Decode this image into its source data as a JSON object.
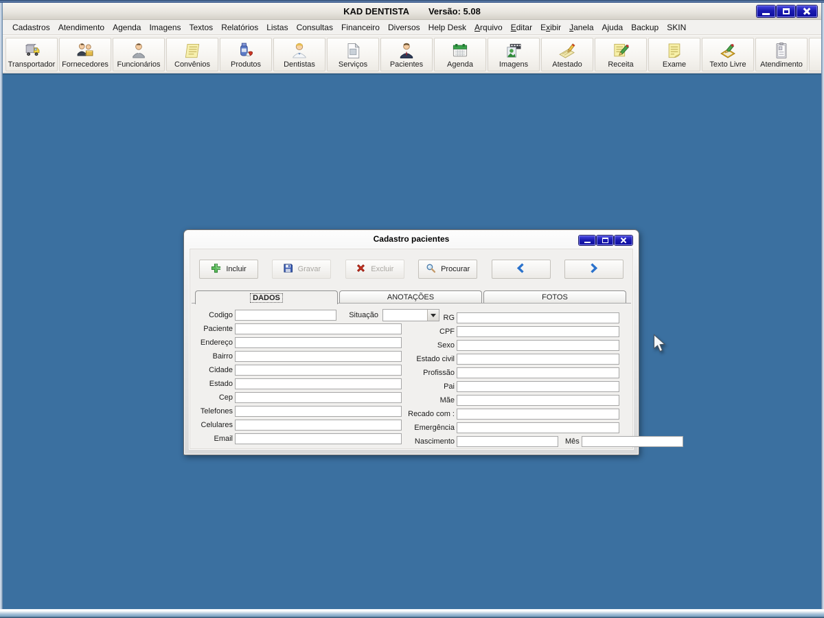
{
  "window": {
    "app_title": "KAD DENTISTA",
    "version": "Versão: 5.08",
    "controls": [
      "minimize",
      "maximize",
      "close"
    ]
  },
  "menu": {
    "items": [
      {
        "id": "cadastros",
        "label": "Cadastros",
        "u": -1
      },
      {
        "id": "atendimento",
        "label": "Atendimento",
        "u": -1
      },
      {
        "id": "agenda",
        "label": "Agenda",
        "u": -1
      },
      {
        "id": "imagens",
        "label": "Imagens",
        "u": -1
      },
      {
        "id": "textos",
        "label": "Textos",
        "u": -1
      },
      {
        "id": "relatorios",
        "label": "Relatórios",
        "u": -1
      },
      {
        "id": "listas",
        "label": "Listas",
        "u": -1
      },
      {
        "id": "consultas",
        "label": "Consultas",
        "u": -1
      },
      {
        "id": "financeiro",
        "label": "Financeiro",
        "u": -1
      },
      {
        "id": "diversos",
        "label": "Diversos",
        "u": -1
      },
      {
        "id": "help-desk",
        "label": "Help Desk",
        "u": -1
      },
      {
        "id": "arquivo",
        "label": "Arquivo",
        "u": 0
      },
      {
        "id": "editar",
        "label": "Editar",
        "u": 0
      },
      {
        "id": "exibir",
        "label": "Exibir",
        "u": 1
      },
      {
        "id": "janela",
        "label": "Janela",
        "u": 0
      },
      {
        "id": "ajuda",
        "label": "Ajuda",
        "u": -1
      },
      {
        "id": "backup",
        "label": "Backup",
        "u": -1
      },
      {
        "id": "skin",
        "label": "SKIN",
        "u": -1
      }
    ]
  },
  "toolbar": {
    "buttons": [
      {
        "id": "transportador",
        "label": "Transportador",
        "icon": "truck"
      },
      {
        "id": "fornecedores",
        "label": "Fornecedores",
        "icon": "people-pair"
      },
      {
        "id": "funcionarios",
        "label": "Funcionários",
        "icon": "person"
      },
      {
        "id": "convenios",
        "label": "Convênios",
        "icon": "note"
      },
      {
        "id": "produtos",
        "label": "Produtos",
        "icon": "medicine"
      },
      {
        "id": "dentistas",
        "label": "Dentistas",
        "icon": "doctor"
      },
      {
        "id": "servicos",
        "label": "Serviços",
        "icon": "document"
      },
      {
        "id": "pacientes",
        "label": "Pacientes",
        "icon": "patient"
      },
      {
        "id": "agenda",
        "label": "Agenda",
        "icon": "calendar"
      },
      {
        "id": "imagens",
        "label": "Imagens",
        "icon": "film"
      },
      {
        "id": "atestado",
        "label": "Atestado",
        "icon": "signing"
      },
      {
        "id": "receita",
        "label": "Receita",
        "icon": "note-pencil"
      },
      {
        "id": "exame",
        "label": "Exame",
        "icon": "note-curl"
      },
      {
        "id": "texto-livre",
        "label": "Texto Livre",
        "icon": "pad-pencil"
      },
      {
        "id": "atendimento",
        "label": "Atendimento",
        "icon": "clipboard"
      }
    ]
  },
  "dialog": {
    "title": "Cadastro pacientes",
    "controls": [
      "minimize",
      "maximize",
      "close"
    ],
    "buttons": [
      {
        "id": "incluir",
        "label": "Incluir",
        "icon": "plus",
        "enabled": true
      },
      {
        "id": "gravar",
        "label": "Gravar",
        "icon": "floppy",
        "enabled": false
      },
      {
        "id": "excluir",
        "label": "Excluir",
        "icon": "red-x",
        "enabled": false
      },
      {
        "id": "procurar",
        "label": "Procurar",
        "icon": "search",
        "enabled": true
      },
      {
        "id": "anterior",
        "label": "",
        "icon": "chevron-left",
        "enabled": true
      },
      {
        "id": "proximo",
        "label": "",
        "icon": "chevron-right",
        "enabled": true
      }
    ],
    "tabs": [
      {
        "id": "dados",
        "label": "DADOS",
        "active": true
      },
      {
        "id": "anotacoes",
        "label": "ANOTAÇÕES",
        "active": false
      },
      {
        "id": "fotos",
        "label": "FOTOS",
        "active": false
      }
    ],
    "form": {
      "codigo": {
        "label": "Codigo",
        "value": ""
      },
      "situacao": {
        "label": "Situação",
        "value": ""
      },
      "left_rows": [
        {
          "id": "paciente",
          "label": "Paciente",
          "value": ""
        },
        {
          "id": "endereco",
          "label": "Endereço",
          "value": ""
        },
        {
          "id": "bairro",
          "label": "Bairro",
          "value": ""
        },
        {
          "id": "cidade",
          "label": "Cidade",
          "value": ""
        },
        {
          "id": "estado",
          "label": "Estado",
          "value": ""
        },
        {
          "id": "cep",
          "label": "Cep",
          "value": ""
        },
        {
          "id": "telefones",
          "label": "Telefones",
          "value": ""
        },
        {
          "id": "celulares",
          "label": "Celulares",
          "value": ""
        },
        {
          "id": "email",
          "label": "Email",
          "value": ""
        }
      ],
      "right_rows": [
        {
          "id": "rg",
          "label": "RG",
          "value": ""
        },
        {
          "id": "cpf",
          "label": "CPF",
          "value": ""
        },
        {
          "id": "sexo",
          "label": "Sexo",
          "value": ""
        },
        {
          "id": "estado-civil",
          "label": "Estado civil",
          "value": ""
        },
        {
          "id": "profissao",
          "label": "Profissão",
          "value": ""
        },
        {
          "id": "pai",
          "label": "Pai",
          "value": ""
        },
        {
          "id": "mae",
          "label": "Mãe",
          "value": ""
        },
        {
          "id": "recado-com",
          "label": "Recado com :",
          "value": ""
        },
        {
          "id": "emergencia",
          "label": "Emergência",
          "value": ""
        }
      ],
      "nascimento": {
        "label": "Nascimento",
        "value": "",
        "mes_label": "Mês",
        "mes_value": ""
      }
    }
  },
  "colors": {
    "desktop": "#3b70a0",
    "control_button_blue": "#1b1bb0",
    "chrome_gray": "#f1efec"
  }
}
